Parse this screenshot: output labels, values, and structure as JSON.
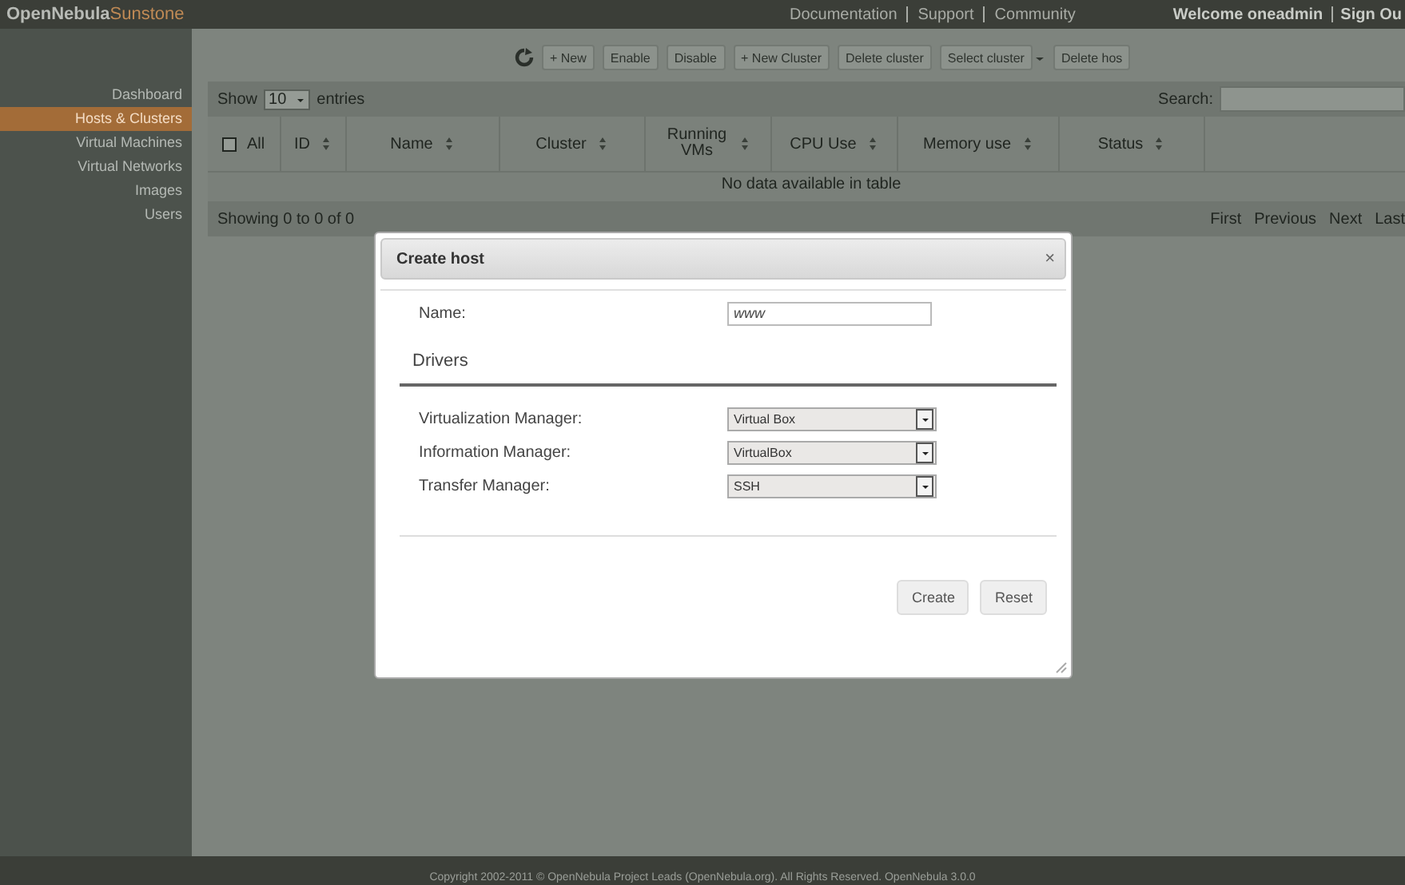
{
  "header": {
    "logo_main": "OpenNebula",
    "logo_sub": "Sunstone",
    "links": [
      "Documentation",
      "Support",
      "Community"
    ],
    "welcome": "Welcome oneadmin",
    "signout": "Sign Ou"
  },
  "sidebar": {
    "items": [
      {
        "label": "Dashboard",
        "selected": false
      },
      {
        "label": "Hosts & Clusters",
        "selected": true
      },
      {
        "label": "Virtual Machines",
        "selected": false
      },
      {
        "label": "Virtual Networks",
        "selected": false
      },
      {
        "label": "Images",
        "selected": false
      },
      {
        "label": "Users",
        "selected": false
      }
    ]
  },
  "toolbar": {
    "buttons": [
      "+ New",
      "Enable",
      "Disable",
      "+ New Cluster",
      "Delete cluster",
      "Select cluster",
      "Delete hos"
    ]
  },
  "table": {
    "show_label": "Show",
    "page_size": "10",
    "entries_label": "entries",
    "search_label": "Search:",
    "select_all": {
      "checked": false
    },
    "columns": [
      "All",
      "ID",
      "Name",
      "Cluster",
      "Running VMs",
      "CPU Use",
      "Memory use",
      "Status"
    ],
    "empty": "No data available in table",
    "info": "Showing 0 to 0 of 0",
    "pager": [
      "First",
      "Previous",
      "Next",
      "Last"
    ]
  },
  "dialog": {
    "title": "Create host",
    "close": "×",
    "name_label": "Name:",
    "name_value": "www",
    "section": "Drivers",
    "fields": [
      {
        "label": "Virtualization Manager:",
        "value": "Virtual Box"
      },
      {
        "label": "Information Manager:",
        "value": "VirtualBox"
      },
      {
        "label": "Transfer Manager:",
        "value": "SSH"
      }
    ],
    "buttons": [
      "Create",
      "Reset"
    ]
  },
  "footer": "Copyright 2002-2011 © OpenNebula Project Leads (OpenNebula.org). All Rights Reserved. OpenNebula 3.0.0"
}
